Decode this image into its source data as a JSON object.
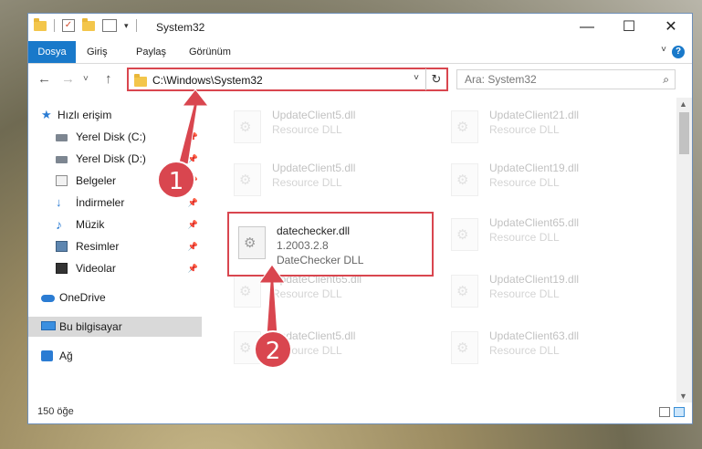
{
  "window": {
    "title": "System32",
    "minimize_glyph": "—",
    "maximize_glyph": "☐",
    "close_glyph": "✕"
  },
  "ribbon": {
    "tabs": [
      "Dosya",
      "Giriş",
      "Paylaş",
      "Görünüm"
    ],
    "help_glyph": "?",
    "collapse_glyph": "˅"
  },
  "nav": {
    "back_glyph": "←",
    "forward_glyph": "→",
    "history_glyph": "˅",
    "up_glyph": "↑",
    "address": "C:\\Windows\\System32",
    "address_dropdown_glyph": "˅",
    "refresh_glyph": "↻",
    "search_placeholder": "Ara: System32",
    "search_glyph": "⌕"
  },
  "sidebar": {
    "items": [
      {
        "label": "Hızlı erişim",
        "icon": "star-icon"
      },
      {
        "label": "Yerel Disk (C:)",
        "icon": "drive-icon",
        "pinned": true
      },
      {
        "label": "Yerel Disk (D:)",
        "icon": "drive-icon",
        "pinned": true
      },
      {
        "label": "Belgeler",
        "icon": "documents-icon",
        "pinned": true
      },
      {
        "label": "İndirmeler",
        "icon": "download-icon",
        "pinned": true
      },
      {
        "label": "Müzik",
        "icon": "music-icon",
        "pinned": true
      },
      {
        "label": "Resimler",
        "icon": "pictures-icon",
        "pinned": true
      },
      {
        "label": "Videolar",
        "icon": "videos-icon",
        "pinned": true
      },
      {
        "label": "OneDrive",
        "icon": "onedrive-icon"
      },
      {
        "label": "Bu bilgisayar",
        "icon": "this-pc-icon",
        "selected": true
      },
      {
        "label": "Ağ",
        "icon": "network-icon"
      }
    ],
    "pin_glyph": "📌"
  },
  "files": [
    {
      "name": "UpdateClient5.dll",
      "sub1": "Resource DLL",
      "faded": true
    },
    {
      "name": "UpdateClient21.dll",
      "sub1": "Resource DLL",
      "faded": true
    },
    {
      "name": "UpdateClient5.dll",
      "sub1": "Resource DLL",
      "faded": true
    },
    {
      "name": "UpdateClient19.dll",
      "sub1": "Resource DLL",
      "faded": true
    },
    {
      "name": "datechecker.dll",
      "sub1": "1.2003.2.8",
      "sub2": "DateChecker DLL",
      "faded": false
    },
    {
      "name": "UpdateClient65.dll",
      "sub1": "Resource DLL",
      "faded": true
    },
    {
      "name": "UpdateClient65.dll",
      "sub1": "Resource DLL",
      "faded": true
    },
    {
      "name": "UpdateClient19.dll",
      "sub1": "Resource DLL",
      "faded": true
    },
    {
      "name": "UpdateClient5.dll",
      "sub1": "Resource DLL",
      "faded": true
    },
    {
      "name": "UpdateClient63.dll",
      "sub1": "Resource DLL",
      "faded": true
    }
  ],
  "status": {
    "item_count": "150 öğe"
  },
  "callouts": [
    "1",
    "2"
  ],
  "colors": {
    "accent": "#1979ca",
    "highlight": "#d9464f"
  }
}
